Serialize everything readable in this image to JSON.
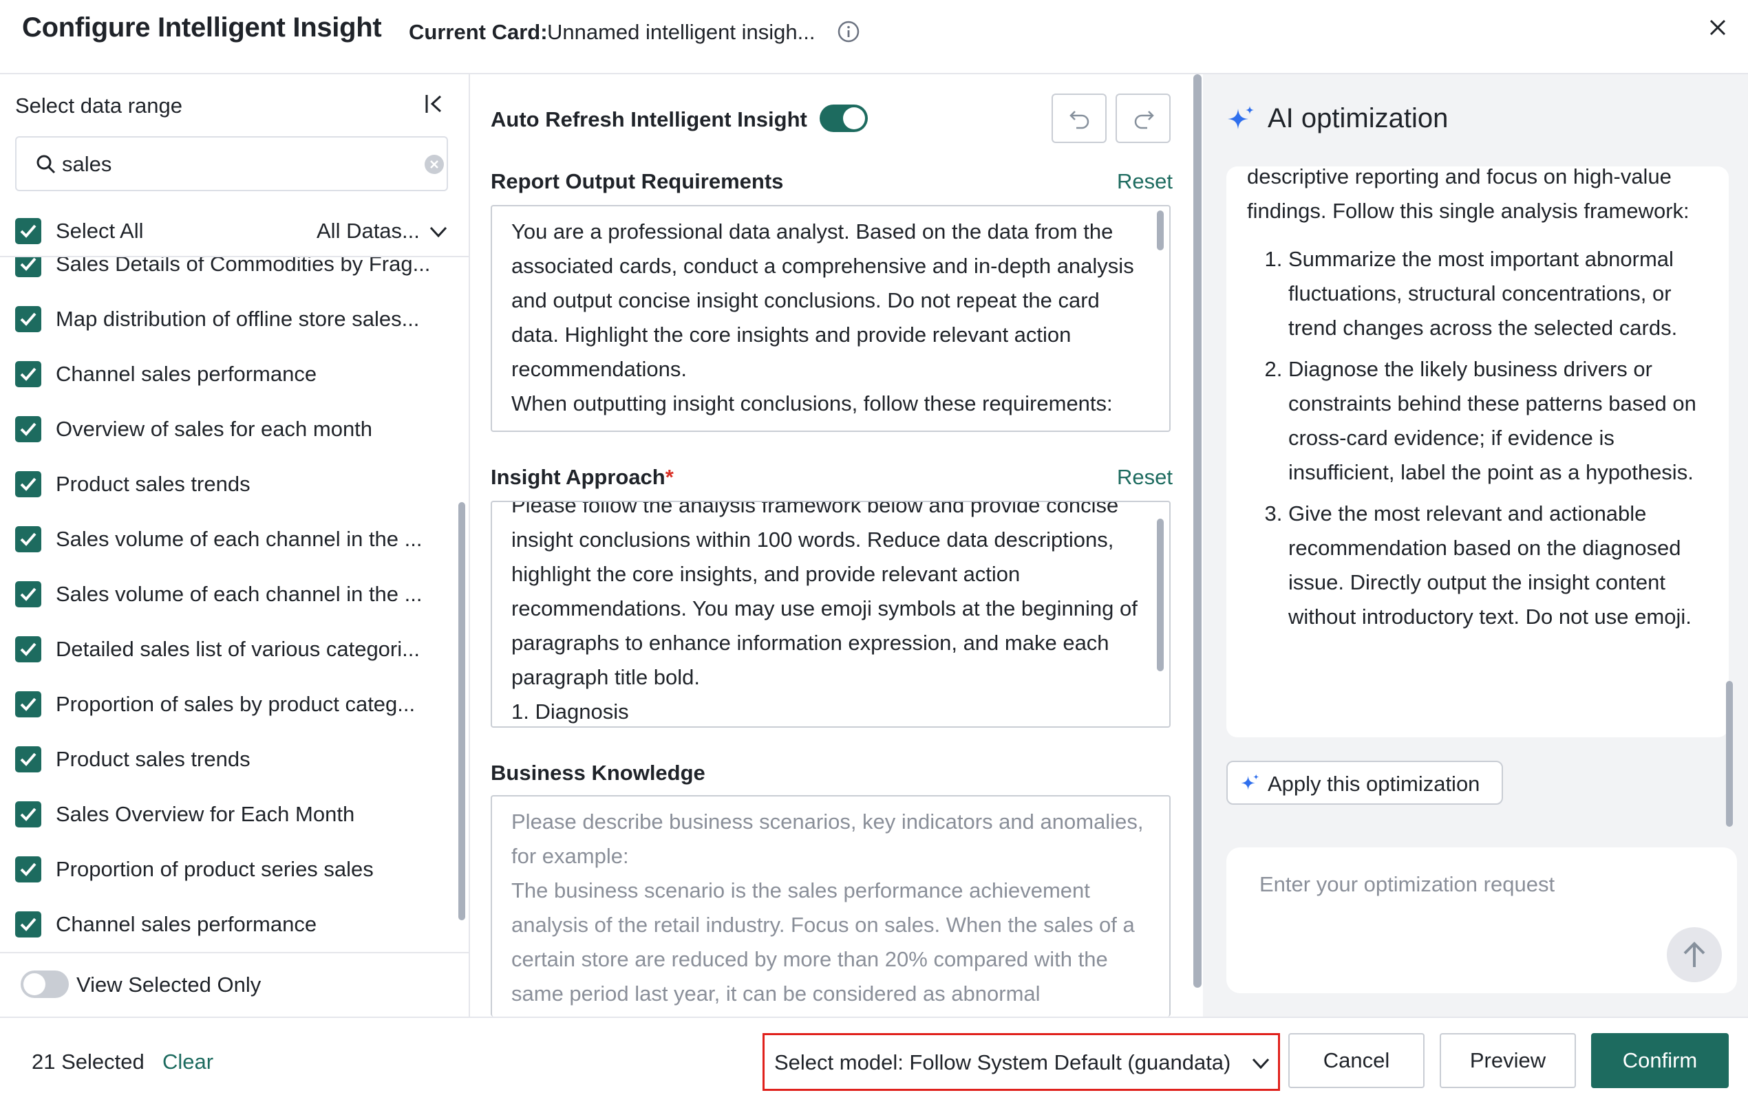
{
  "header": {
    "title": "Configure Intelligent Insight",
    "current_card_label": "Current Card:",
    "current_card_name": "Unnamed intelligent insigh..."
  },
  "data_range": {
    "title": "Select data range",
    "search": {
      "value": "sales",
      "placeholder": ""
    },
    "select_all_label": "Select All",
    "dataset_filter": "All Datas...",
    "items": [
      {
        "label": "Sales Details of Commodities by Frag...",
        "checked": true
      },
      {
        "label": "Map distribution of offline store sales...",
        "checked": true
      },
      {
        "label": "Channel sales performance",
        "checked": true
      },
      {
        "label": "Overview of sales for each month",
        "checked": true
      },
      {
        "label": "Product sales trends",
        "checked": true
      },
      {
        "label": "Sales volume of each channel in the ...",
        "checked": true
      },
      {
        "label": "Sales volume of each channel in the ...",
        "checked": true
      },
      {
        "label": "Detailed sales list of various categori...",
        "checked": true
      },
      {
        "label": "Proportion of sales by product categ...",
        "checked": true
      },
      {
        "label": "Product sales trends",
        "checked": true
      },
      {
        "label": "Sales Overview for Each Month",
        "checked": true
      },
      {
        "label": "Proportion of product series sales",
        "checked": true
      },
      {
        "label": "Channel sales performance",
        "checked": true
      }
    ],
    "view_selected_label": "View Selected Only",
    "view_selected_on": false
  },
  "config": {
    "auto_refresh_label": "Auto Refresh Intelligent Insight",
    "auto_refresh_on": true,
    "report_output": {
      "title": "Report Output Requirements",
      "reset_label": "Reset",
      "text": "You are a professional data analyst. Based on the data from the associated cards, conduct a comprehensive and in-depth analysis and output concise insight conclusions. Do not repeat the card data. Highlight the core insights and provide relevant action recommendations.\nWhen outputting insight conclusions, follow these requirements:"
    },
    "insight_approach": {
      "title": "Insight Approach",
      "required_mark": "*",
      "reset_label": "Reset",
      "text": "Please follow the analysis framework below and provide concise insight conclusions within 100 words. Reduce data descriptions, highlight the core insights, and provide relevant action recommendations. You may use emoji symbols at the beginning of paragraphs to enhance information expression, and make each paragraph title bold.\n1. Diagnosis"
    },
    "business_knowledge": {
      "title": "Business Knowledge",
      "placeholder": "Please describe business scenarios, key indicators and anomalies, for example:\nThe business scenario is the sales performance achievement analysis of the retail industry. Focus on sales. When the sales of a certain store are reduced by more than 20% compared with the same period last year, it can be considered as abnormal"
    }
  },
  "ai_optimization": {
    "title": "AI optimization",
    "intro": "descriptive reporting and focus on high-value findings. Follow this single analysis framework:",
    "steps": [
      "Summarize the most important abnormal fluctuations, structural concentrations, or trend changes across the selected cards.",
      "Diagnose the likely business drivers or constraints behind these patterns based on cross-card evidence; if evidence is insufficient, label the point as a hypothesis.",
      "Give the most relevant and actionable recommendation based on the diagnosed issue. Directly output the insight content without introductory text. Do not use emoji."
    ],
    "apply_label": "Apply this optimization",
    "input_placeholder": "Enter your optimization request"
  },
  "footer": {
    "selected_count": "21 Selected",
    "clear_label": "Clear",
    "model_select": "Select model: Follow System Default (guandata)",
    "cancel_label": "Cancel",
    "preview_label": "Preview",
    "confirm_label": "Confirm"
  },
  "colors": {
    "accent": "#1d6b5f",
    "highlight_border": "#e0211c",
    "panel_bg": "#f2f3f5",
    "required": "#d93025"
  }
}
